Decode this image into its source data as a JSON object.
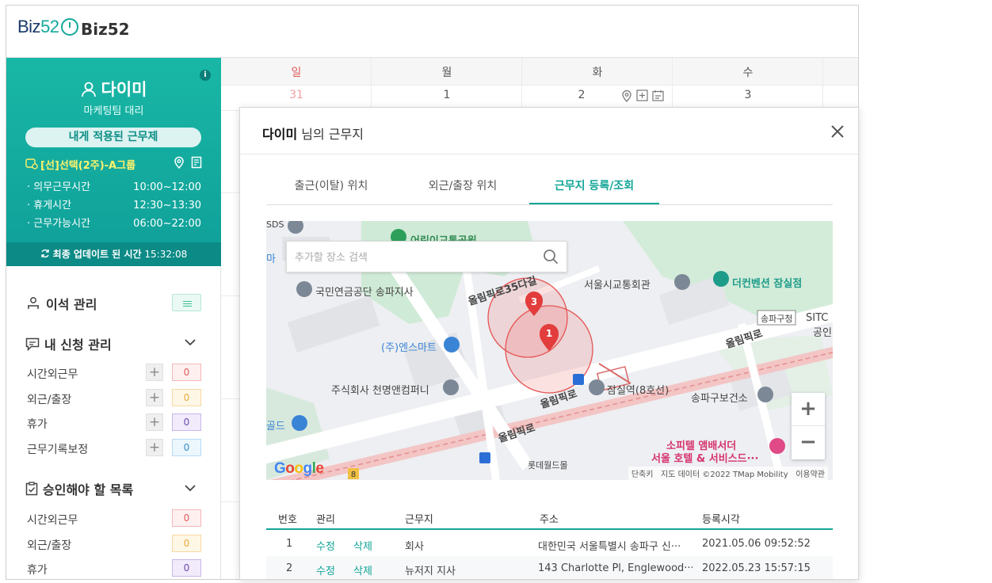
{
  "header": {
    "logo_text": "Biz",
    "logo_num": "52",
    "title": "Biz52"
  },
  "profile": {
    "info": "i",
    "name": "다이미",
    "role": "마케팅팀 대리",
    "pill": "내게 적용된 근무제",
    "plan": "[선]선택(2주)-A그룹",
    "hours": [
      {
        "label": "· 의무근무시간",
        "value": "10:00~12:00"
      },
      {
        "label": "· 휴게시간",
        "value": "12:30~13:30"
      },
      {
        "label": "· 근무가능시간",
        "value": "06:00~22:00"
      }
    ],
    "update_label": "최종 업데이트 된 시간",
    "update_time": "15:32:08"
  },
  "menu": {
    "seat": "이석 관리",
    "my_requests": "내 신청 관리",
    "requests": [
      {
        "label": "시간외근무",
        "count": "0"
      },
      {
        "label": "외근/출장",
        "count": "0"
      },
      {
        "label": "휴가",
        "count": "0"
      },
      {
        "label": "근무기록보정",
        "count": "0"
      }
    ],
    "approvals_title": "승인해야 할 목록",
    "approvals": [
      {
        "label": "시간외근무",
        "count": "0"
      },
      {
        "label": "외근/출장",
        "count": "0"
      },
      {
        "label": "휴가",
        "count": "0"
      }
    ]
  },
  "calendar": {
    "days": [
      "일",
      "월",
      "화",
      "수"
    ],
    "dates": [
      "31",
      "1",
      "2",
      "3"
    ],
    "colors": {
      "sunday": "#e05a5a"
    }
  },
  "modal": {
    "user": "다이미",
    "title_suffix": " 님의 근무지",
    "tabs": [
      "출근(이탈) 위치",
      "외근/출장 위치",
      "근무지 등록/조회"
    ],
    "active_tab": 2,
    "search_placeholder": "추가할 장소 검색",
    "map_labels": {
      "sds": "SDS",
      "park": "어린이교통공원",
      "ma": "마",
      "nps": "국민연금공단 송파지사",
      "seoul_court": "서울시교통회관",
      "convention": "더컨벤션 잠실점",
      "road35": "올림픽로35다길",
      "entsmart": "(주)엔스마트",
      "chun": "주식회사 천명앤컴퍼니",
      "jamsil": "잠실역(8호선)",
      "olympic1": "올림픽로",
      "olympic2": "올림픽로",
      "olympic3": "올림픽로",
      "songpa_gu": "송파구청",
      "sitc": "SITC",
      "gong": "공인",
      "health": "송파구보건소",
      "gold": "골드",
      "sofitel1": "소피텔 앰배서더",
      "sofitel2": "서울 호텔 & 서비스드···",
      "lotte": "롯데월드몰",
      "road_num": "8",
      "marker1": "1",
      "marker3": "3",
      "shortcut": "단축키",
      "mapdata": "지도 데이터 ©2022 TMap Mobility",
      "terms": "이용약관",
      "google": "Google"
    },
    "table": {
      "headers": [
        "번호",
        "관리",
        "근무지",
        "주소",
        "등록시각"
      ],
      "edit": "수정",
      "delete": "삭제",
      "rows": [
        {
          "no": "1",
          "place": "회사",
          "address": "대한민국 서울특별시 송파구 신···",
          "time": "2021.05.06 09:52:52"
        },
        {
          "no": "2",
          "place": "뉴저지 지사",
          "address": "143 Charlotte Pl, Englewood···",
          "time": "2022.05.23 15:57:15"
        }
      ]
    }
  },
  "colors": {
    "accent": "#12a597",
    "sidebar_top": "#19b7a5",
    "sidebar_bottom": "#0b8a86",
    "plan": "#fff36b"
  }
}
